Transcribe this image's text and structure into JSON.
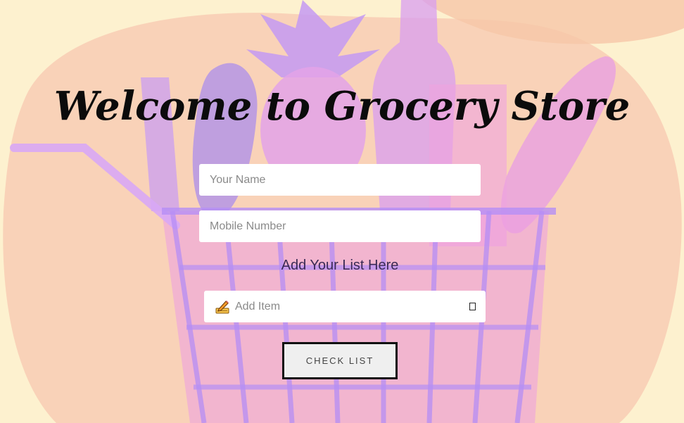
{
  "page": {
    "title": "Welcome to Grocery Store"
  },
  "form": {
    "name_placeholder": "Your Name",
    "mobile_placeholder": "Mobile Number",
    "list_heading": "Add Your List Here",
    "item_placeholder": "Add Item",
    "item_icon": "pencil-writing-icon",
    "add_icon": "add-box-icon",
    "check_button_label": "CHECK LIST"
  },
  "background": {
    "illustration": "grocery-basket-illustration",
    "colors": {
      "base": "#fdf1cf",
      "blob": "#f8cfb5",
      "basket": "#c79af5",
      "fruits": "#d99cf0"
    }
  }
}
